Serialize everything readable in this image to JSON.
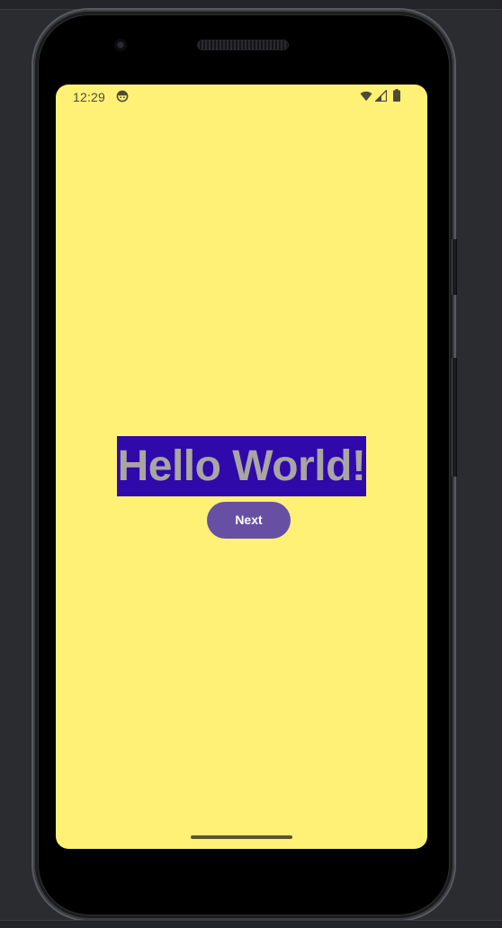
{
  "status_bar": {
    "time": "12:29",
    "app_icon": "android-face-icon",
    "wifi_icon": "wifi-icon",
    "signal_icon": "cell-signal-icon",
    "battery_icon": "battery-icon",
    "text_color": "#4e4a37"
  },
  "main": {
    "headline": "Hello World!",
    "headline_background": "#2f09aa",
    "headline_color": "#a9a5a3",
    "next_button_label": "Next",
    "button_color": "#6750a4"
  },
  "screen": {
    "background": "#fff176"
  },
  "device": {
    "frame_color": "#000000",
    "workspace_background": "#2b2c30"
  }
}
